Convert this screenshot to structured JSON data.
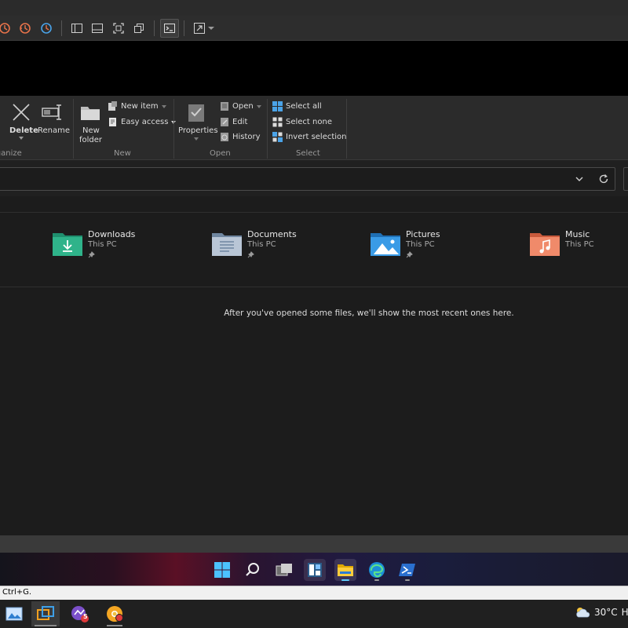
{
  "host_toolbar": {
    "icons": [
      "history-icon",
      "history-alt-icon",
      "history-clock-icon",
      "sidebar-layout-icon",
      "bottom-panel-layout-icon",
      "fullscreen-icon",
      "restore-window-icon",
      "terminal-icon",
      "resize-icon",
      "dropdown-arrow-icon"
    ]
  },
  "ribbon": {
    "delete_label": "Delete",
    "rename_label": "Rename",
    "organize_group": "Organize",
    "new_folder_label_1": "New",
    "new_folder_label_2": "folder",
    "new_item_label": "New item",
    "easy_access_label": "Easy access",
    "new_group": "New",
    "properties_label": "Properties",
    "open_label": "Open",
    "edit_label": "Edit",
    "history_label": "History",
    "open_group": "Open",
    "select_all_label": "Select all",
    "select_none_label": "Select none",
    "invert_selection_label": "Invert selection",
    "select_group": "Select"
  },
  "address_bar": {
    "value": ""
  },
  "quick_access": [
    {
      "name": "Downloads",
      "location": "This PC",
      "icon": "downloads-folder-icon",
      "color": "#2fb38a"
    },
    {
      "name": "Documents",
      "location": "This PC",
      "icon": "documents-folder-icon",
      "color": "#8aa2bd"
    },
    {
      "name": "Pictures",
      "location": "This PC",
      "icon": "pictures-folder-icon",
      "color": "#2f8fdc"
    },
    {
      "name": "Music",
      "location": "This PC",
      "icon": "music-folder-icon",
      "color": "#e86b55"
    }
  ],
  "recent_empty_message": "After you've opened some files, we'll show the most recent ones here.",
  "windows_taskbar": {
    "icons": [
      "start-icon",
      "search-icon",
      "task-view-icon",
      "widgets-icon",
      "file-explorer-icon",
      "edge-icon",
      "powershell-icon"
    ]
  },
  "hint_bar": {
    "text": "Ctrl+G."
  },
  "host_taskbar": {
    "icons": [
      "photo-viewer-icon",
      "vm-app-icon",
      "messaging-app-icon",
      "chrome-canary-icon"
    ],
    "badge": "5",
    "weather_temp": "30°C",
    "weather_extra": "H"
  },
  "colors": {
    "accent": "#60cdff",
    "ribbon_bg": "#2b2b2b",
    "content_bg": "#1c1c1c"
  }
}
